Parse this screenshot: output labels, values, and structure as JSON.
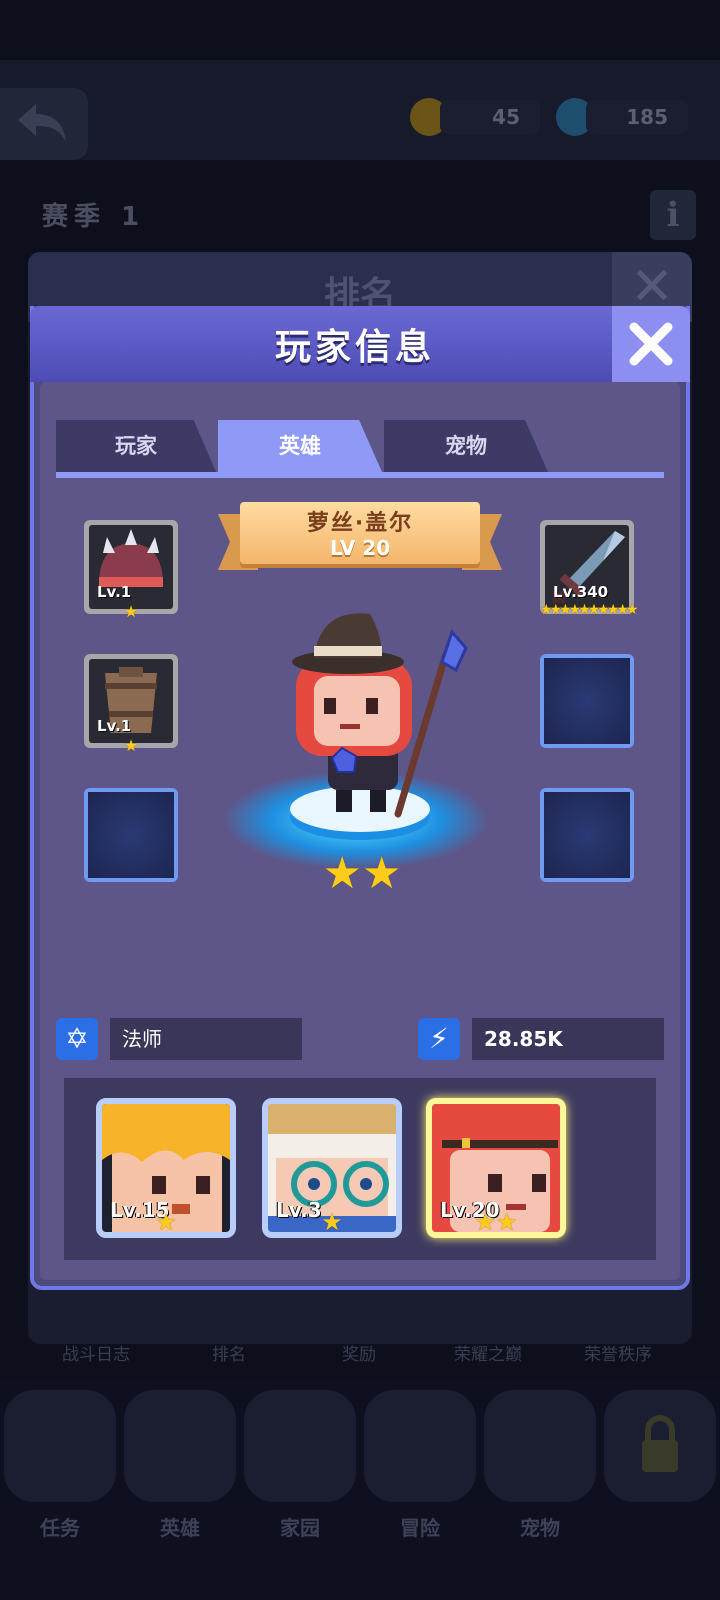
{
  "background": {
    "currency": [
      {
        "icon": "coin-icon",
        "value": "45"
      },
      {
        "icon": "gem-icon",
        "value": "185"
      }
    ],
    "season": "赛季 1",
    "info_label": "i",
    "panel_title": "排名",
    "bottom_tabs": [
      "战斗日志",
      "排名",
      "奖励",
      "荣耀之巅",
      "荣誉秩序"
    ],
    "nav_items": [
      "任务",
      "英雄",
      "家园",
      "冒险",
      "宠物"
    ]
  },
  "modal": {
    "title": "玩家信息",
    "tabs": [
      {
        "label": "玩家",
        "active": false
      },
      {
        "label": "英雄",
        "active": true
      },
      {
        "label": "宠物",
        "active": false
      }
    ],
    "hero": {
      "name": "萝丝·盖尔",
      "level": "LV 20",
      "stars": "★★"
    },
    "left_slots": [
      {
        "item": "spiked-helmet",
        "level": "Lv.1",
        "stars": "★"
      },
      {
        "item": "barrel-armor",
        "level": "Lv.1",
        "stars": "★"
      },
      {
        "item": "empty",
        "level": "",
        "stars": ""
      }
    ],
    "right_slots": [
      {
        "item": "sword",
        "level": "Lv.340",
        "stars": "★★★★★★★★★★"
      },
      {
        "item": "empty",
        "level": "",
        "stars": ""
      },
      {
        "item": "empty",
        "level": "",
        "stars": ""
      }
    ],
    "class_label": "法师",
    "power_value": "28.85K",
    "roster": [
      {
        "name": "blonde-hero",
        "level": "Lv.15",
        "stars": "★",
        "selected": false
      },
      {
        "name": "glasses-hero",
        "level": "Lv.3",
        "stars": "★",
        "selected": false
      },
      {
        "name": "red-hair-hero",
        "level": "Lv.20",
        "stars": "★★",
        "selected": true
      }
    ]
  }
}
